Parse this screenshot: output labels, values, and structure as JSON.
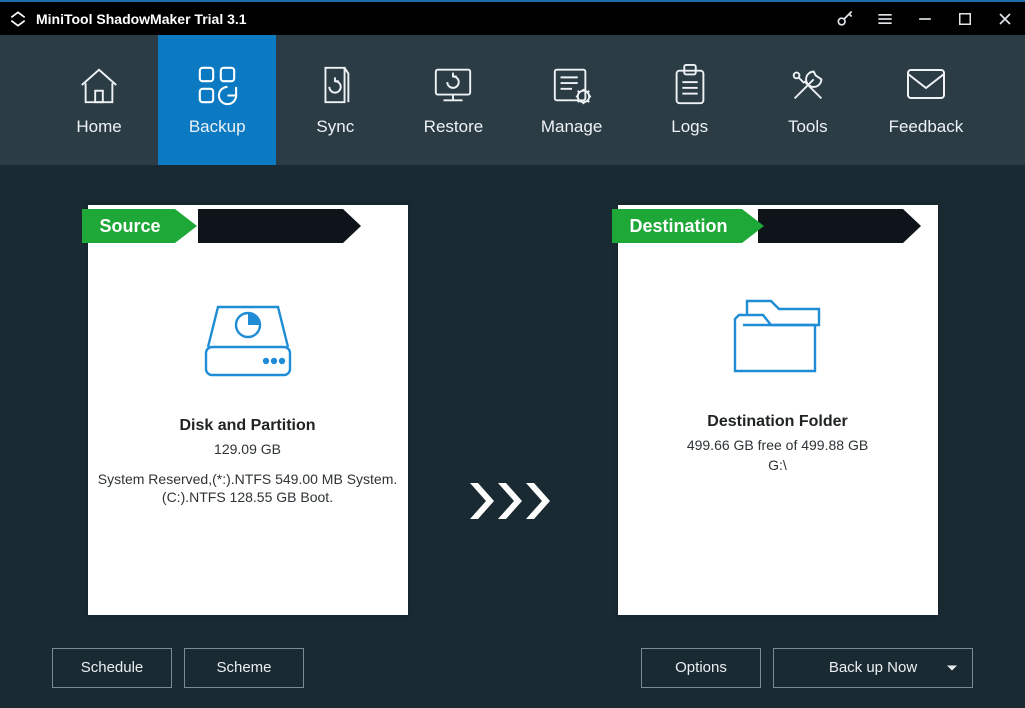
{
  "window": {
    "title": "MiniTool ShadowMaker Trial 3.1"
  },
  "nav": {
    "home": {
      "label": "Home"
    },
    "backup": {
      "label": "Backup"
    },
    "sync": {
      "label": "Sync"
    },
    "restore": {
      "label": "Restore"
    },
    "manage": {
      "label": "Manage"
    },
    "logs": {
      "label": "Logs"
    },
    "tools": {
      "label": "Tools"
    },
    "feedback": {
      "label": "Feedback"
    }
  },
  "source": {
    "ribbon": "Source",
    "title": "Disk and Partition",
    "size": "129.09 GB",
    "line1": "System Reserved,(*:).NTFS 549.00 MB System.",
    "line2": "(C:).NTFS 128.55 GB Boot."
  },
  "destination": {
    "ribbon": "Destination",
    "title": "Destination Folder",
    "free": "499.66 GB free of 499.88 GB",
    "path": "G:\\"
  },
  "buttons": {
    "schedule": "Schedule",
    "scheme": "Scheme",
    "options": "Options",
    "backup_now": "Back up Now"
  }
}
